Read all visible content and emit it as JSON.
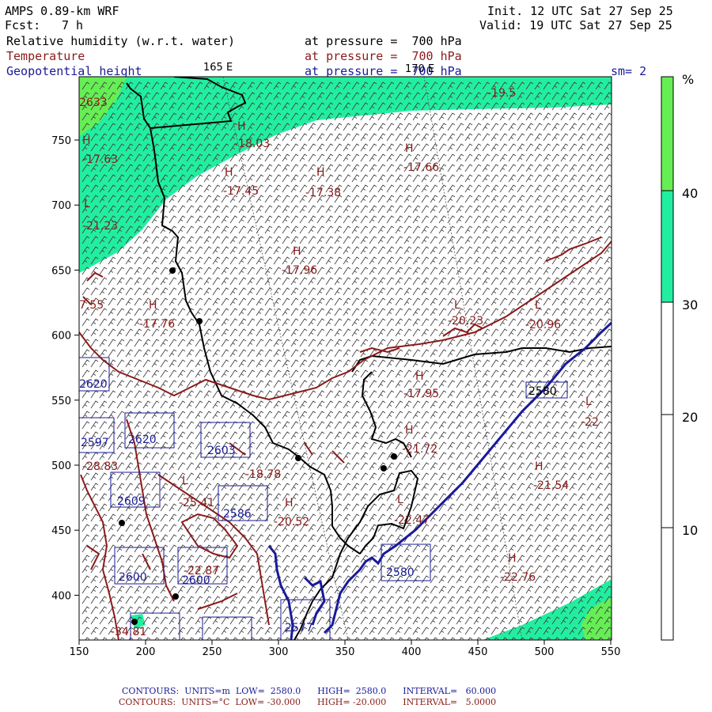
{
  "header": {
    "model": "AMPS 0.89-km WRF",
    "init": "Init. 12 UTC Sat 27 Sep 25",
    "fcst_label": "Fcst:",
    "fcst_value": "7 h",
    "valid": "Valid: 19 UTC Sat 27 Sep 25"
  },
  "fields": [
    {
      "name": "Relative humidity (w.r.t. water)",
      "level": "at pressure =  700 hPa",
      "color": "#000000"
    },
    {
      "name": "Temperature",
      "level": "at pressure =  700 hPa",
      "color": "#8b1a1a"
    },
    {
      "name": "Geopotential height",
      "level": "at pressure =  700 hPa",
      "color": "#1a1a9a"
    }
  ],
  "smoothing": "sm= 2",
  "meridians": {
    "left": "165 E",
    "right": "170 E"
  },
  "colorbar": {
    "unit": "%",
    "ticks": [
      "40",
      "30",
      "20",
      "10"
    ],
    "colors": {
      "above_40": "#66ee55",
      "30_40": "#22eea0",
      "below_30": "#ffffff"
    }
  },
  "axes": {
    "x_ticks": [
      "150",
      "200",
      "250",
      "300",
      "350",
      "400",
      "450",
      "500",
      "550"
    ],
    "y_ticks": [
      "750",
      "700",
      "650",
      "600",
      "550",
      "500",
      "450",
      "400"
    ]
  },
  "map_labels": {
    "highs": [
      {
        "mark": "H",
        "value": "-17.63"
      },
      {
        "mark": "H",
        "value": "-18.03"
      },
      {
        "mark": "H",
        "value": "-17.45"
      },
      {
        "mark": "H",
        "value": "-17.38"
      },
      {
        "mark": "H",
        "value": "-17.66"
      },
      {
        "mark": "H",
        "value": "-17.96"
      },
      {
        "mark": "H",
        "value": "-17.76"
      },
      {
        "mark": "H",
        "value": "-17.95"
      },
      {
        "mark": "H",
        "value": "-21.72"
      },
      {
        "mark": "H",
        "value": "-20.52"
      },
      {
        "mark": "H",
        "value": "-22.76"
      },
      {
        "mark": "H",
        "value": "-21.54"
      },
      {
        "mark": "H",
        "value": "-18.78"
      }
    ],
    "lows": [
      {
        "mark": "L",
        "value": "-21.23"
      },
      {
        "mark": "L",
        "value": "-20.23"
      },
      {
        "mark": "L",
        "value": "-20.96"
      },
      {
        "mark": "L",
        "value": "-25.41"
      },
      {
        "mark": "L",
        "value": "-22.47"
      },
      {
        "mark": "L",
        "value": "-22"
      }
    ],
    "edge_values": [
      "-19.5",
      "2633",
      "7.55",
      "-28.83",
      "-34.81",
      "-22.87"
    ],
    "height_boxes": [
      "2620",
      "2620",
      "2597",
      "2603",
      "2609",
      "2586",
      "2600",
      "2600",
      "2580",
      "2577",
      "2580"
    ]
  },
  "footer": {
    "height_line": {
      "label": "CONTOURS:  UNITS=m",
      "low": "LOW=  2580.0",
      "high": "HIGH=  2580.0",
      "interval": "INTERVAL=   60.000"
    },
    "temp_line": {
      "label": "CONTOURS:  UNITS=°C",
      "low": "LOW= -30.000",
      "high": "HIGH= -20.000",
      "interval": "INTERVAL=   5.0000"
    }
  }
}
